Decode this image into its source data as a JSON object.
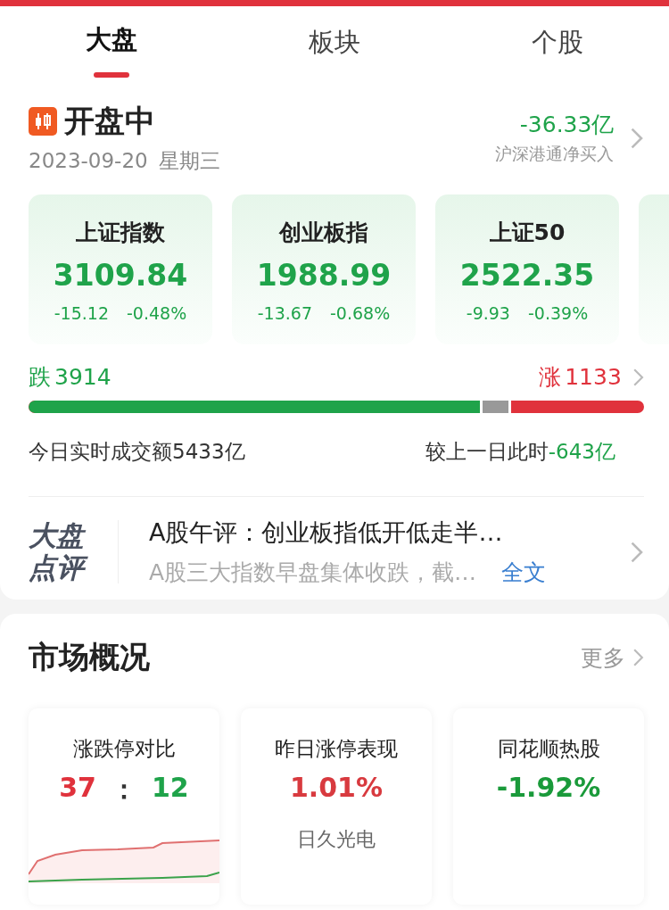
{
  "tabs": [
    {
      "label": "大盘",
      "selected": true
    },
    {
      "label": "板块",
      "selected": false
    },
    {
      "label": "个股",
      "selected": false
    }
  ],
  "status": {
    "title": "开盘中",
    "date": "2023-09-20",
    "weekday": "星期三",
    "flow_value": "-36.33亿",
    "flow_label": "沪深港通净买入"
  },
  "indices": [
    {
      "name": "上证指数",
      "value": "3109.84",
      "change": "-15.12",
      "percent": "-0.48%"
    },
    {
      "name": "创业板指",
      "value": "1988.99",
      "change": "-13.67",
      "percent": "-0.68%"
    },
    {
      "name": "上证50",
      "value": "2522.35",
      "change": "-9.93",
      "percent": "-0.39%"
    }
  ],
  "breadth": {
    "fall_label": "跌",
    "fall_count": "3914",
    "rise_label": "涨",
    "rise_count": "1133",
    "level": 0.733
  },
  "turnover": {
    "label": "今日实时成交额5433亿",
    "compare_label": "较上一日此时",
    "compare_value": "-643亿"
  },
  "commentary": {
    "logo_top": "大盘",
    "logo_bottom": "点评",
    "headline": "A股午评：创业板指低开低走半…",
    "summary": "A股三大指数早盘集体收跌，截…",
    "link": "全文"
  },
  "overview": {
    "title": "市场概况",
    "more": "更多",
    "cards": [
      {
        "kind": "ratio",
        "title": "涨跌停对比",
        "up": "37",
        "separator": "：",
        "down": "12"
      },
      {
        "kind": "stat",
        "title": "昨日涨停表现",
        "value": "1.01%",
        "color": "#d83a3f",
        "sub": "日久光电"
      },
      {
        "kind": "stat",
        "title": "同花顺热股",
        "value": "-1.92%",
        "color": "#1a9a3a"
      }
    ]
  }
}
